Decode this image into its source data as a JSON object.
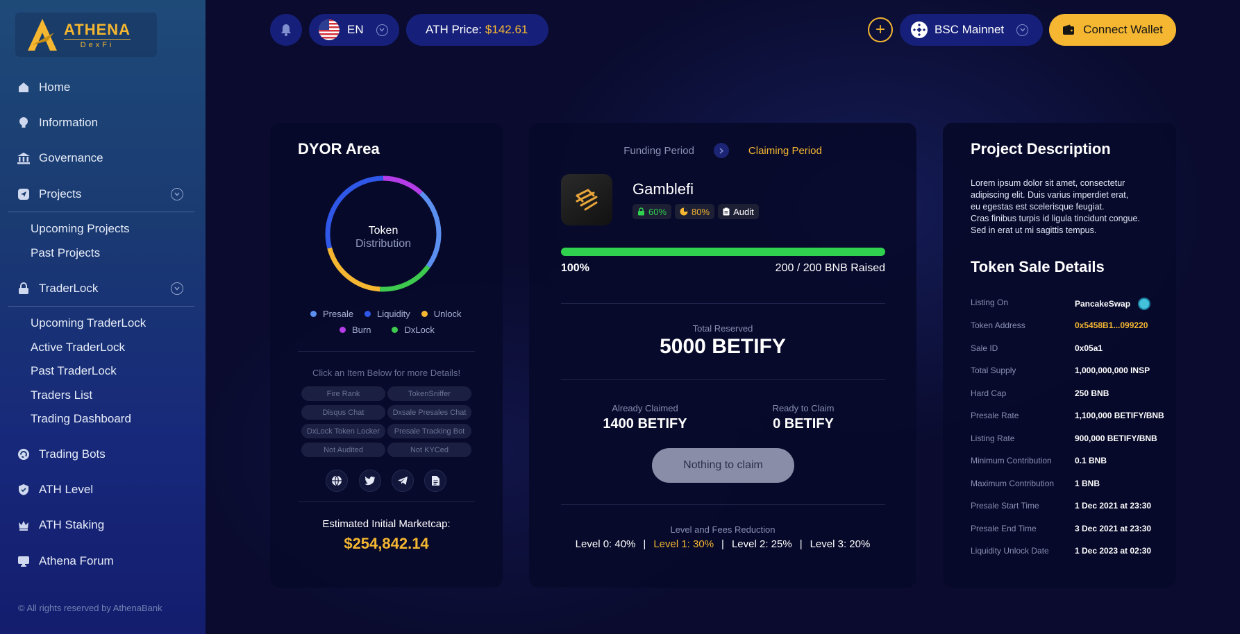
{
  "brand": {
    "name": "ATHENA",
    "sub": "DexFi"
  },
  "colors": {
    "accent": "#f5b731",
    "progress": "#2fd14f",
    "sidebar_top": "#1e4a78",
    "sidebar_bottom": "#141d6e"
  },
  "sidebar": {
    "items": [
      {
        "label": "Home",
        "icon": "home-icon"
      },
      {
        "label": "Information",
        "icon": "bulb-icon"
      },
      {
        "label": "Governance",
        "icon": "bank-icon"
      },
      {
        "label": "Projects",
        "icon": "send-icon",
        "children": [
          "Upcoming Projects",
          "Past Projects"
        ]
      },
      {
        "label": "TraderLock",
        "icon": "lock-icon",
        "children": [
          "Upcoming TraderLock",
          "Active TraderLock",
          "Past TraderLock",
          "Traders List",
          "Trading Dashboard"
        ]
      },
      {
        "label": "Trading Bots",
        "icon": "bot-icon"
      },
      {
        "label": "ATH Level",
        "icon": "shield-check-icon"
      },
      {
        "label": "ATH Staking",
        "icon": "crown-icon"
      },
      {
        "label": "Athena Forum",
        "icon": "monitor-icon"
      }
    ],
    "copyright": "© All rights reserved by AthenaBank"
  },
  "topbar": {
    "language": "EN",
    "price_label": "ATH Price:",
    "price_value": "$142.61",
    "network": "BSC Mainnet",
    "wallet_label": "Connect Wallet"
  },
  "dyor": {
    "title": "DYOR Area",
    "donut_label_1": "Token",
    "donut_label_2": "Distribution",
    "legend": [
      {
        "name": "Presale",
        "color": "#5b8ff0"
      },
      {
        "name": "Liquidity",
        "color": "#2f57e8"
      },
      {
        "name": "Unlock",
        "color": "#f5b731"
      },
      {
        "name": "Burn",
        "color": "#b43de8"
      },
      {
        "name": "DxLock",
        "color": "#3dca4e"
      }
    ],
    "hint": "Click an Item Below for more Details!",
    "tags": [
      "Fire Rank",
      "TokenSniffer",
      "Disqus Chat",
      "Dxsale Presales Chat",
      "DxLock Token Locker",
      "Presale Tracking Bot",
      "Not Audited",
      "Not KYCed"
    ],
    "socials": [
      "globe-icon",
      "twitter-icon",
      "telegram-icon",
      "document-icon"
    ],
    "est_label": "Estimated Initial Marketcap:",
    "est_value": "$254,842.14"
  },
  "sale": {
    "step1": "Funding Period",
    "step2": "Claiming Period",
    "project": "Gamblefi",
    "badges": [
      {
        "text": "60%",
        "icon": "lock-icon",
        "color": "#2fd14f"
      },
      {
        "text": "80%",
        "icon": "pie-icon",
        "color": "#f5b731"
      },
      {
        "text": "Audit",
        "icon": "clipboard-icon",
        "color": "#ffffff"
      }
    ],
    "progress": 1.0,
    "progress_label": "100%",
    "raised": "200 / 200 BNB Raised",
    "total_reserved_label": "Total Reserved",
    "total_reserved": "5000 BETIFY",
    "claimed_label": "Already Claimed",
    "claimed": "1400 BETIFY",
    "ready_label": "Ready to Claim",
    "ready": "0 BETIFY",
    "claim_button": "Nothing to claim",
    "levels_label": "Level and Fees Reduction",
    "levels": [
      "Level 0: 40%",
      "Level 1: 30%",
      "Level 2: 25%",
      "Level 3: 20%"
    ]
  },
  "project": {
    "desc_title": "Project Description",
    "desc_lines": [
      "Lorem ipsum dolor sit amet, consectetur",
      "adipiscing elit. Duis varius imperdiet erat,",
      "eu egestas est scelerisque feugiat.",
      "Cras finibus turpis id ligula tincidunt congue.",
      "Sed in erat ut mi sagittis tempus."
    ],
    "details_title": "Token Sale Details",
    "details": [
      {
        "k": "Listing On",
        "v": "PancakeSwap"
      },
      {
        "k": "Token Address",
        "v": "0x5458B1...099220"
      },
      {
        "k": "Sale ID",
        "v": "0x05a1"
      },
      {
        "k": "Total Supply",
        "v": "1,000,000,000 INSP"
      },
      {
        "k": "Hard Cap",
        "v": "250 BNB"
      },
      {
        "k": "Presale Rate",
        "v": "1,100,000 BETIFY/BNB"
      },
      {
        "k": "Listing Rate",
        "v": "900,000 BETIFY/BNB"
      },
      {
        "k": "Minimum Contribution",
        "v": "0.1 BNB"
      },
      {
        "k": "Maximum Contribution",
        "v": "1 BNB"
      },
      {
        "k": "Presale Start Time",
        "v": "1 Dec 2021 at 23:30"
      },
      {
        "k": "Presale End Time",
        "v": "3 Dec 2021 at 23:30"
      },
      {
        "k": "Liquidity Unlock Date",
        "v": "1 Dec 2023 at 02:30"
      }
    ]
  }
}
